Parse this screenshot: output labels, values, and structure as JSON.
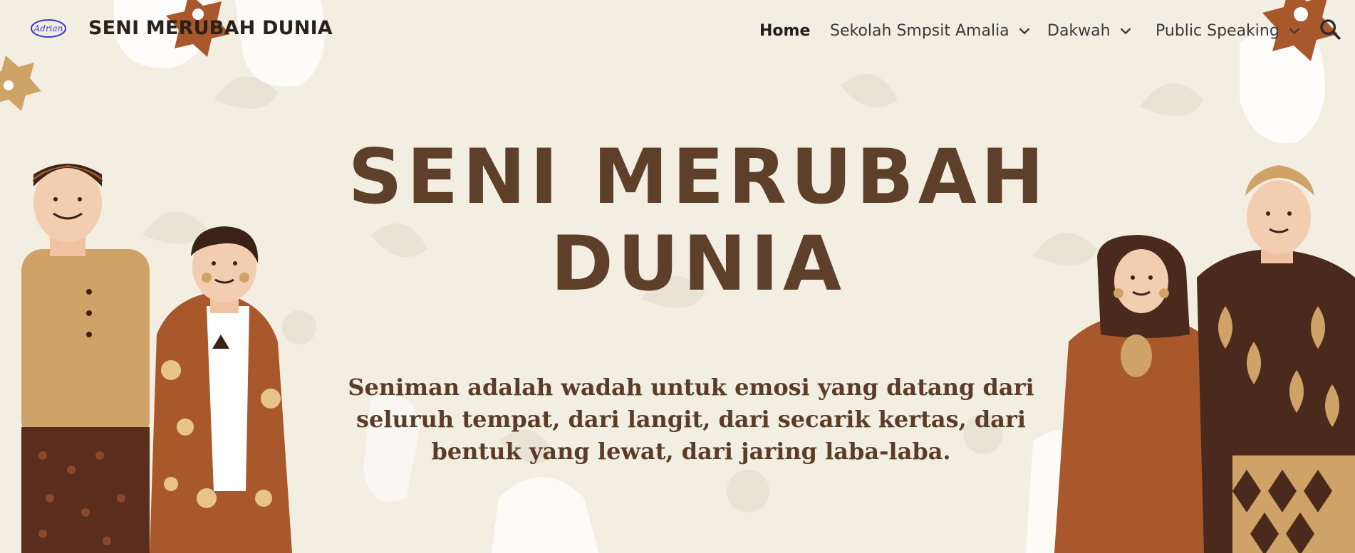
{
  "header": {
    "logo_text": "Adrian",
    "site_title": "SENI MERUBAH DUNIA"
  },
  "nav": {
    "items": [
      {
        "label": "Home",
        "active": true,
        "has_dropdown": false
      },
      {
        "label": "Sekolah Smpsit Amalia",
        "active": false,
        "has_dropdown": true
      },
      {
        "label": "Dakwah",
        "active": false,
        "has_dropdown": true
      },
      {
        "label": "Public Speaking",
        "active": false,
        "has_dropdown": true
      }
    ],
    "search_icon": "search-icon",
    "chevron_icon": "chevron-down-icon"
  },
  "hero": {
    "headline": "SENI MERUBAH DUNIA",
    "quote": "Seniman adalah wadah untuk emosi yang datang dari seluruh tempat, dari langit, dari secarik kertas, dari bentuk yang lewat, dari jaring laba-laba."
  },
  "colors": {
    "background": "#f3eee2",
    "headline": "#5e3f2a",
    "accent_brown": "#a9582c",
    "dark_brown": "#4a2a1c",
    "tan": "#cfa267"
  }
}
